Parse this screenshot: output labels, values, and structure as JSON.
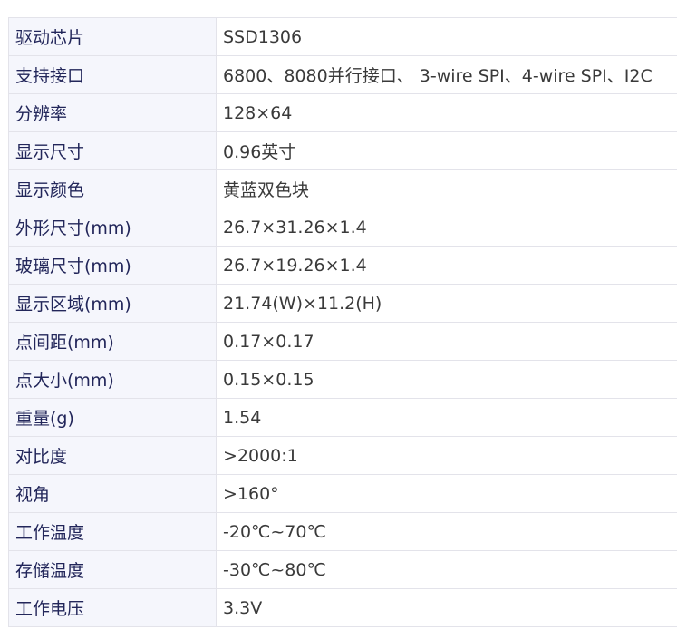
{
  "specs": [
    {
      "label": "驱动芯片",
      "value": "SSD1306"
    },
    {
      "label": "支持接口",
      "value": "6800、8080并行接口、 3-wire SPI、4-wire SPI、I2C"
    },
    {
      "label": "分辨率",
      "value": "128×64"
    },
    {
      "label": "显示尺寸",
      "value": "0.96英寸"
    },
    {
      "label": "显示颜色",
      "value": "黄蓝双色块"
    },
    {
      "label": "外形尺寸(mm)",
      "value": "26.7×31.26×1.4"
    },
    {
      "label": "玻璃尺寸(mm)",
      "value": "26.7×19.26×1.4"
    },
    {
      "label": "显示区域(mm)",
      "value": "21.74(W)×11.2(H)"
    },
    {
      "label": "点间距(mm)",
      "value": "0.17×0.17"
    },
    {
      "label": "点大小(mm)",
      "value": "0.15×0.15"
    },
    {
      "label": "重量(g)",
      "value": "1.54"
    },
    {
      "label": "对比度",
      "value": ">2000:1"
    },
    {
      "label": "视角",
      "value": ">160°"
    },
    {
      "label": "工作温度",
      "value": "-20℃~70℃"
    },
    {
      "label": "存储温度",
      "value": "-30℃~80℃"
    },
    {
      "label": "工作电压",
      "value": "3.3V"
    }
  ]
}
